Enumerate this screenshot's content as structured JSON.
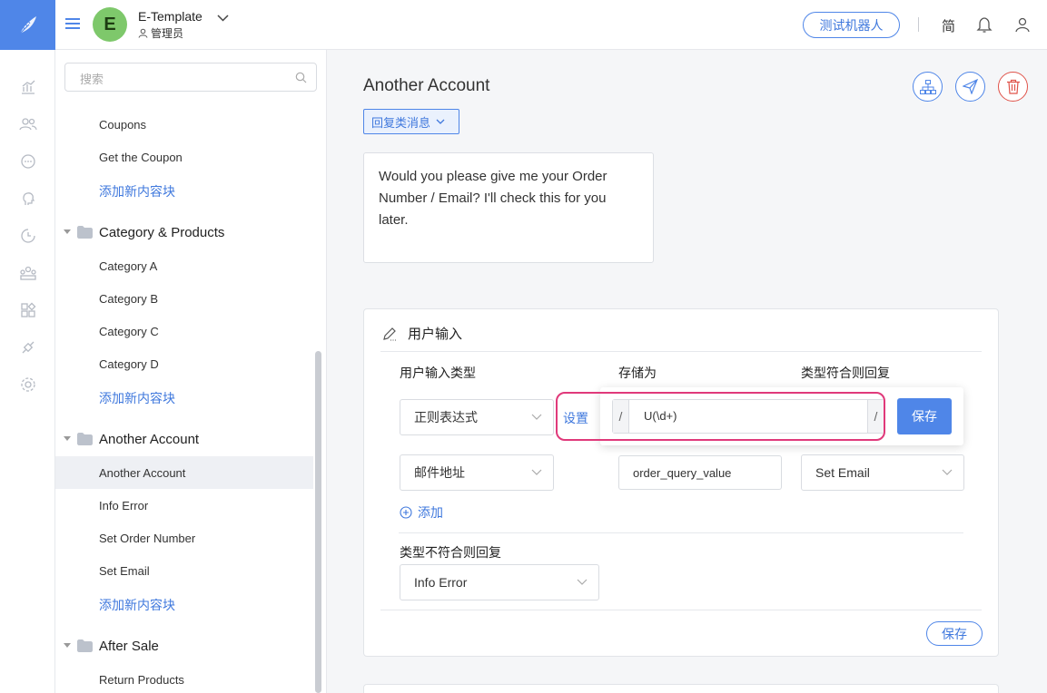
{
  "header": {
    "app_name": "E-Template",
    "avatar_letter": "E",
    "role": "管理员",
    "test_bot_label": "测试机器人",
    "lang_label": "简"
  },
  "rail_icons": [
    "chart-icon",
    "users-icon",
    "chat-icon",
    "brain-icon",
    "history-icon",
    "team-icon",
    "apps-icon",
    "plugin-icon",
    "settings-icon"
  ],
  "tree": {
    "search_placeholder": "搜索",
    "items_top": [
      "Coupons",
      "Get the Coupon"
    ],
    "add_label": "添加新内容块",
    "categories": [
      {
        "name": "Category & Products",
        "items": [
          "Category A",
          "Category B",
          "Category C",
          "Category D"
        ]
      },
      {
        "name": "Another Account",
        "items": [
          "Another Account",
          "Info Error",
          "Set Order Number",
          "Set Email"
        ]
      },
      {
        "name": "After Sale",
        "items": [
          "Return Products"
        ]
      }
    ]
  },
  "main": {
    "title": "Another Account",
    "message_type": "回复类消息",
    "message_text": "Would you please give me your Order Number / Email? I'll check this for you later."
  },
  "user_input": {
    "section_title": "用户输入",
    "col_type": "用户输入类型",
    "col_store": "存储为",
    "col_reply": "类型符合则回复",
    "row1_type": "正则表达式",
    "set_label": "设置",
    "regex_slash": "/",
    "regex_value": "U(\\d+)",
    "popover_save": "保存",
    "row2_type": "邮件地址",
    "row2_store": "order_query_value",
    "row2_reply": "Set Email",
    "add_label": "添加",
    "mismatch_label": "类型不符合则回复",
    "mismatch_value": "Info Error",
    "save_label": "保存"
  },
  "colors": {
    "accent": "#4f86e8",
    "link": "#3f78dd",
    "danger": "#e0534a",
    "highlight": "#e0397a",
    "avatar": "#7ec86b"
  }
}
